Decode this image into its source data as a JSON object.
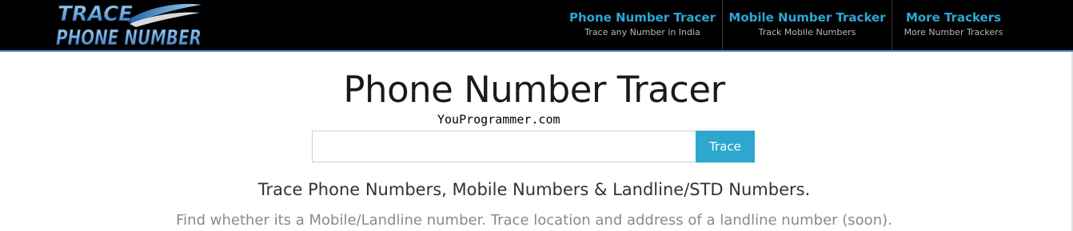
{
  "header": {
    "logo": {
      "line1": "TRACE",
      "line2": "PHONE NUMBER"
    },
    "nav": [
      {
        "title": "Phone Number Tracer",
        "subtitle": "Trace any Number in India"
      },
      {
        "title": "Mobile Number Tracker",
        "subtitle": "Track Mobile Numbers"
      },
      {
        "title": "More Trackers",
        "subtitle": "More Number Trackers"
      }
    ]
  },
  "main": {
    "title": "Phone Number Tracer",
    "watermark": "YouProgrammer.com",
    "search": {
      "value": "",
      "placeholder": ""
    },
    "trace_button": "Trace",
    "tagline": "Trace Phone Numbers, Mobile Numbers & Landline/STD Numbers.",
    "subline": "Find whether its a Mobile/Landline number. Trace location and address of a landline number (soon)."
  },
  "colors": {
    "topbar_bg": "#000000",
    "nav_title": "#2ca6d6",
    "nav_subtitle": "#b8b8b8",
    "button_bg": "#2ea7cf",
    "topbar_border": "#3a8fc7"
  }
}
